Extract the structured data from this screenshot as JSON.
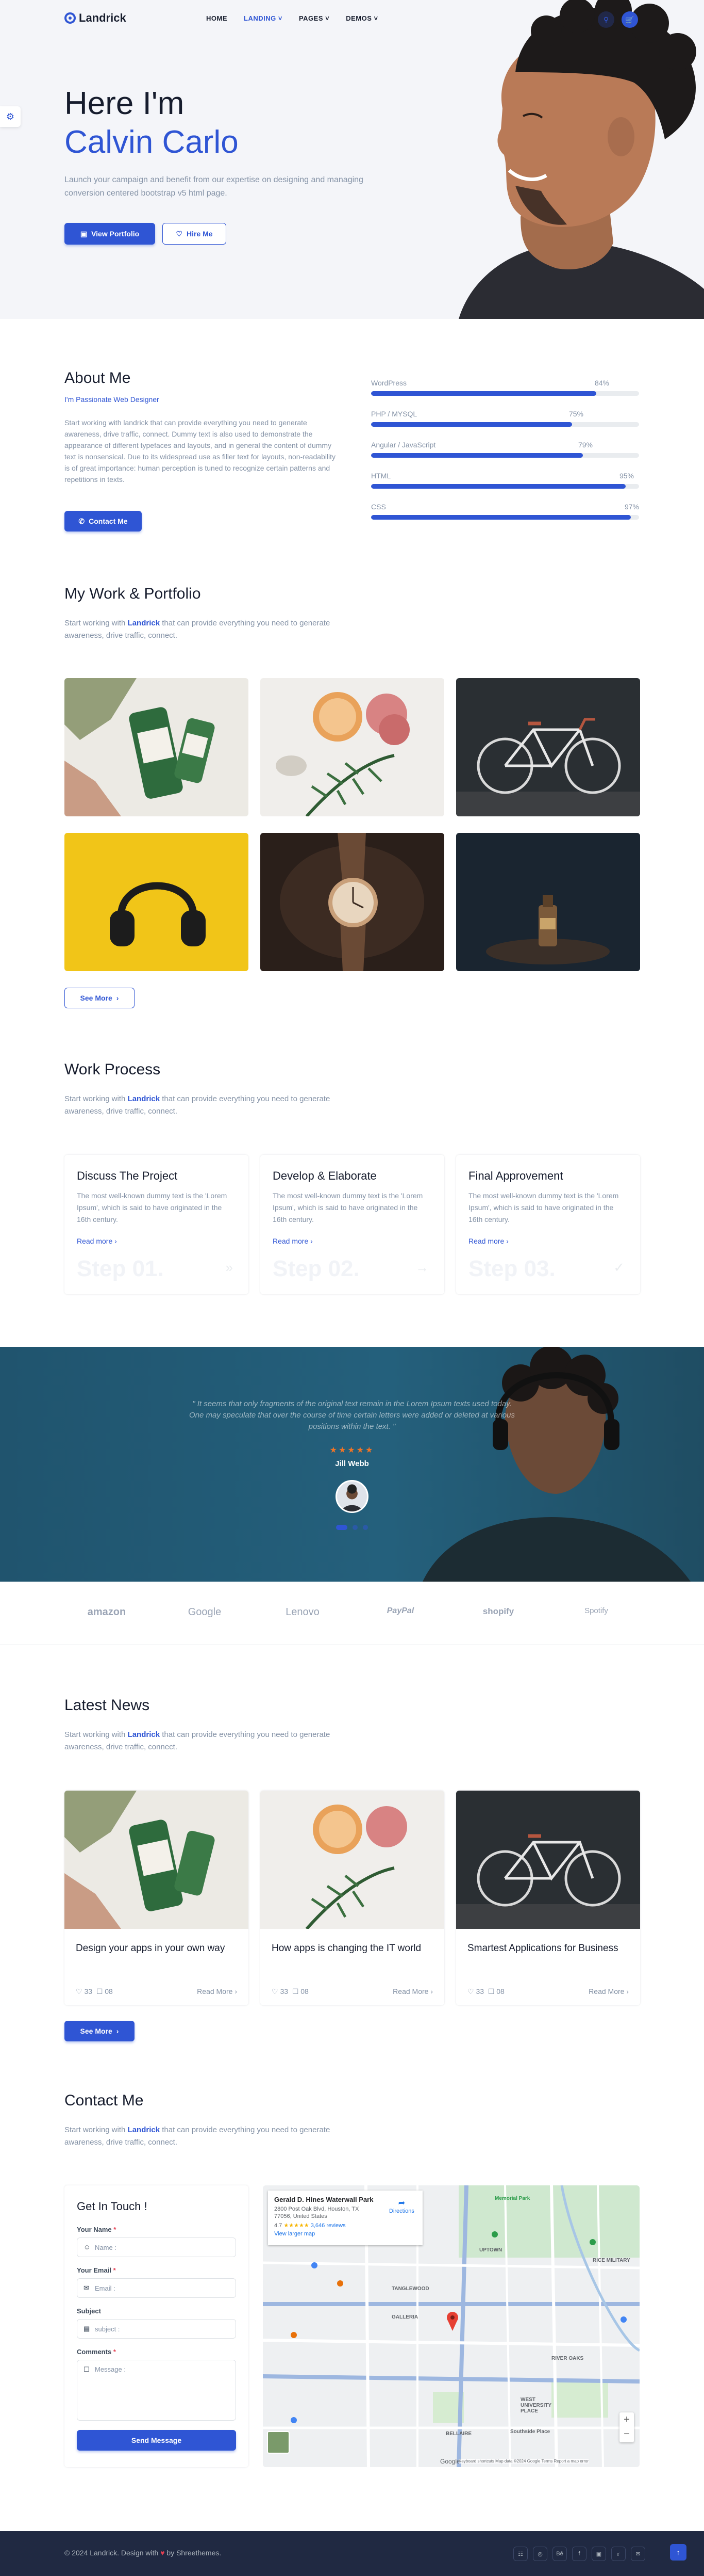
{
  "nav": {
    "logo": "Landrick",
    "menu": [
      {
        "label": "HOME",
        "active": false,
        "dropdown": false
      },
      {
        "label": "LANDING",
        "active": true,
        "dropdown": true
      },
      {
        "label": "PAGES",
        "active": false,
        "dropdown": true
      },
      {
        "label": "DEMOS",
        "active": false,
        "dropdown": true
      }
    ],
    "icons": [
      "search-icon",
      "cart-icon"
    ]
  },
  "hero": {
    "title_line1": "Here I'm",
    "title_line2": "Calvin Carlo",
    "subtitle": "Launch your campaign and benefit from our expertise on designing and managing conversion centered bootstrap v5 html page.",
    "btn_portfolio": "View Portfolio",
    "btn_hire": "Hire Me"
  },
  "about": {
    "title": "About Me",
    "tagline": "I'm Passionate Web Designer",
    "text": "Start working with landrick that can provide everything you need to generate awareness, drive traffic, connect. Dummy text is also used to demonstrate the appearance of different typefaces and layouts, and in general the content of dummy text is nonsensical. Due to its widespread use as filler text for layouts, non-readability is of great importance: human perception is tuned to recognize certain patterns and repetitions in texts.",
    "btn_contact": "Contact Me",
    "skills": [
      {
        "name": "WordPress",
        "value": "84%",
        "pct": 0.84
      },
      {
        "name": "PHP / MYSQL",
        "value": "75%",
        "pct": 0.75
      },
      {
        "name": "Angular / JavaScript",
        "value": "79%",
        "pct": 0.79
      },
      {
        "name": "HTML",
        "value": "95%",
        "pct": 0.95
      },
      {
        "name": "CSS",
        "value": "97%",
        "pct": 0.97
      }
    ]
  },
  "portfolio": {
    "title": "My Work & Portfolio",
    "sub_prefix": "Start working with ",
    "sub_brand": "Landrick",
    "sub_suffix": " that can provide everything you need to generate awareness, drive traffic, connect.",
    "btn_more": "See More"
  },
  "process": {
    "title": "Work Process",
    "sub_prefix": "Start working with ",
    "sub_brand": "Landrick",
    "sub_suffix": " that can provide everything you need to generate awareness, drive traffic, connect.",
    "cards": [
      {
        "title": "Discuss The Project",
        "text": "The most well-known dummy text is the 'Lorem Ipsum', which is said to have originated in the 16th century.",
        "link": "Read more",
        "step": "Step 01."
      },
      {
        "title": "Develop & Elaborate",
        "text": "The most well-known dummy text is the 'Lorem Ipsum', which is said to have originated in the 16th century.",
        "link": "Read more",
        "step": "Step 02."
      },
      {
        "title": "Final Approvement",
        "text": "The most well-known dummy text is the 'Lorem Ipsum', which is said to have originated in the 16th century.",
        "link": "Read more",
        "step": "Step 03."
      }
    ]
  },
  "testimonial": {
    "quote": "\" It seems that only fragments of the original text remain in the Lorem Ipsum texts used today. One may speculate that over the course of time certain letters were added or deleted at various positions within the text. \"",
    "stars": "★★★★★",
    "name": "Jill Webb"
  },
  "clients": [
    "amazon",
    "Google",
    "Lenovo",
    "PayPal",
    "shopify",
    "Spotify"
  ],
  "news": {
    "title": "Latest News",
    "sub_prefix": "Start working with ",
    "sub_brand": "Landrick",
    "sub_suffix": " that can provide everything you need to generate awareness, drive traffic, connect.",
    "cards": [
      {
        "title": "Design your apps in your own way",
        "likes": "33",
        "comments": "08",
        "link": "Read More"
      },
      {
        "title": "How apps is changing the IT world",
        "likes": "33",
        "comments": "08",
        "link": "Read More"
      },
      {
        "title": "Smartest Applications for Business",
        "likes": "33",
        "comments": "08",
        "link": "Read More"
      }
    ],
    "btn_more": "See More"
  },
  "contact": {
    "title": "Contact Me",
    "sub_prefix": "Start working with ",
    "sub_brand": "Landrick",
    "sub_suffix": " that can provide everything you need to generate awareness, drive traffic, connect.",
    "form_title": "Get In Touch !",
    "name_label": "Your Name",
    "name_placeholder": "Name :",
    "email_label": "Your Email",
    "email_placeholder": "Email :",
    "subject_label": "Subject",
    "subject_placeholder": "subject :",
    "comments_label": "Comments",
    "comments_placeholder": "Message :",
    "required_mark": "*",
    "send_label": "Send Message"
  },
  "map": {
    "place_name": "Gerald D. Hines Waterwall Park",
    "address": "2800 Post Oak Blvd, Houston, TX 77056, United States",
    "rating": "4.7",
    "stars": "★★★★★",
    "reviews": "3,646 reviews",
    "larger_map": "View larger map",
    "directions": "Directions",
    "labels": [
      "UPTOWN",
      "GALLERIA",
      "RICE MILITARY",
      "RIVER OAKS",
      "WEST UNIVERSITY PLACE",
      "BELLAIRE",
      "Southside Place",
      "Memorial Park",
      "TANGLEWOOD"
    ],
    "attribution": "Keyboard shortcuts  Map data ©2024 Google  Terms  Report a map error",
    "google": "Google"
  },
  "footer": {
    "copyright_prefix": "© 2024 Landrick. Design with ",
    "heart": "♥",
    "copyright_suffix": " by Shreethemes.",
    "socials": [
      "shopping-cart-icon",
      "dribbble-icon",
      "behance-icon",
      "facebook-icon",
      "instagram-icon",
      "twitter-icon",
      "mail-icon"
    ]
  },
  "colors": {
    "primary": "#2f55d4",
    "dark": "#161c2d",
    "muted": "#8492a6",
    "testimonial_bg": "#24607c",
    "footer_bg": "#202942",
    "star": "#f17425",
    "heart": "#e43f52"
  }
}
